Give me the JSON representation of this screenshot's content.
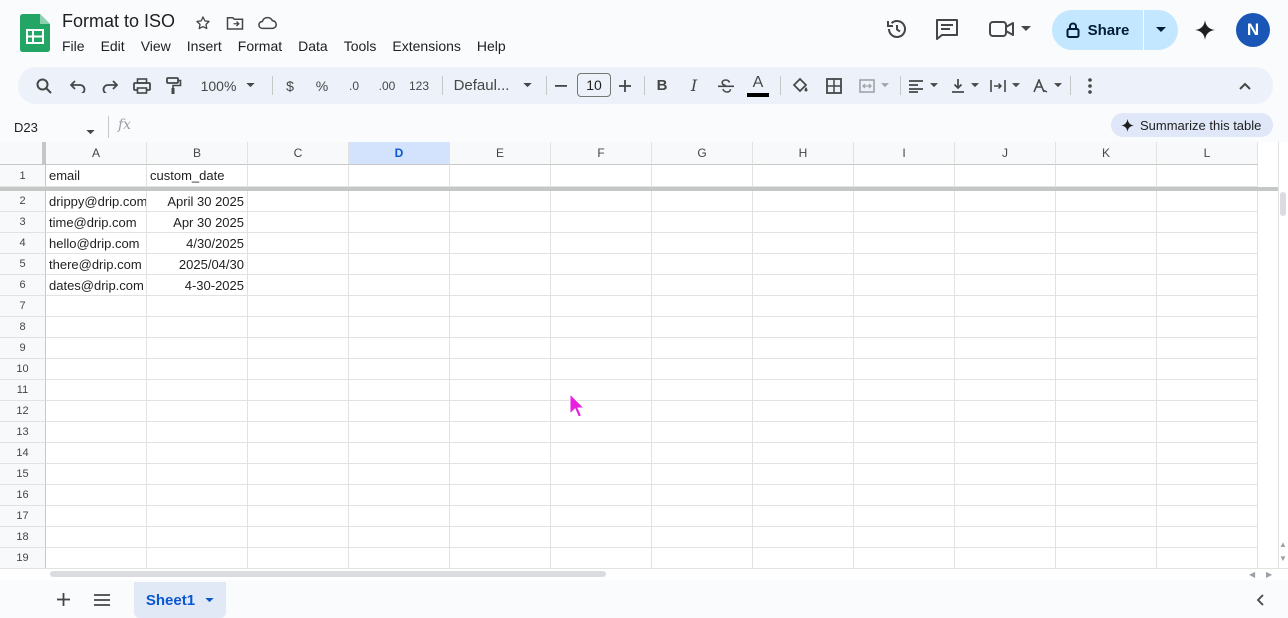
{
  "app": {
    "title": "Format to ISO",
    "menu": [
      "File",
      "Edit",
      "View",
      "Insert",
      "Format",
      "Data",
      "Tools",
      "Extensions",
      "Help"
    ],
    "share_label": "Share",
    "avatar_initial": "N"
  },
  "toolbar": {
    "zoom": "100%",
    "currency": "$",
    "percent": "%",
    "decrease_decimal": ".0",
    "increase_decimal": ".00",
    "number_format": "123",
    "font": "Defaul...",
    "font_size": "10",
    "bold": "B",
    "italic": "I",
    "text_color_glyph": "A"
  },
  "formula_bar": {
    "name_box": "D23",
    "fx": "fx",
    "summarize_label": "Summarize this table"
  },
  "grid": {
    "columns": [
      "A",
      "B",
      "C",
      "D",
      "E",
      "F",
      "G",
      "H",
      "I",
      "J",
      "K",
      "L"
    ],
    "selected_column": "D",
    "row_numbers": [
      "1",
      "2",
      "3",
      "4",
      "5",
      "6",
      "7",
      "8",
      "9",
      "10",
      "11",
      "12",
      "13",
      "14",
      "15",
      "16",
      "17",
      "18",
      "19"
    ],
    "header_row": [
      "email",
      "custom_date"
    ],
    "rows": [
      [
        "drippy@drip.com",
        "April 30 2025"
      ],
      [
        "time@drip.com",
        "Apr 30 2025"
      ],
      [
        "hello@drip.com",
        "4/30/2025"
      ],
      [
        "there@drip.com",
        "2025/04/30"
      ],
      [
        "dates@drip.com",
        "4-30-2025"
      ]
    ]
  },
  "sheets": {
    "active": "Sheet1"
  },
  "colors": {
    "accent": "#0b57d0",
    "share_bg": "#c2e7ff",
    "avatar": "#1a56b6",
    "cursor": "#e81ee0"
  }
}
